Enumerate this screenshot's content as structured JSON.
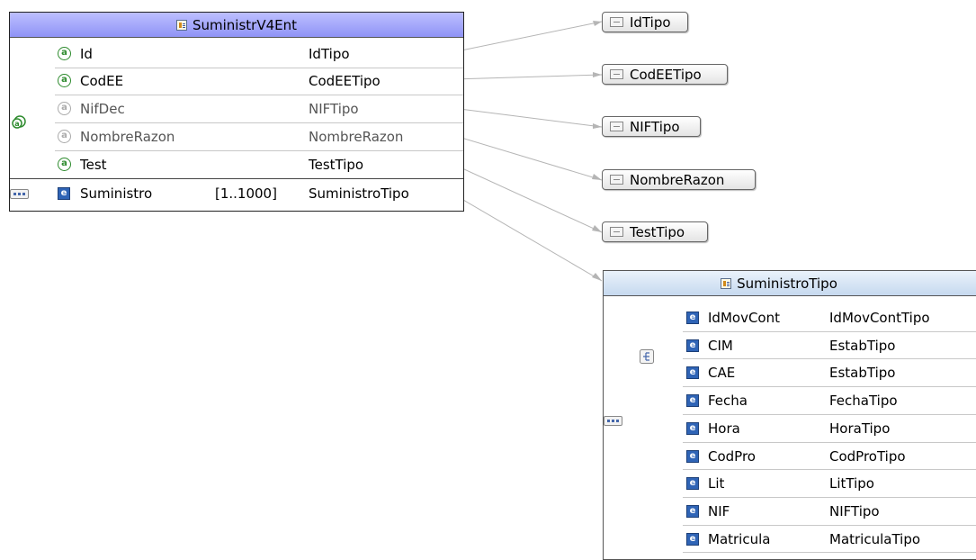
{
  "main_type": {
    "title": "SuministrV4Ent",
    "rows": [
      {
        "kind": "attribute",
        "optional": false,
        "name": "Id",
        "card": "",
        "type": "IdTipo"
      },
      {
        "kind": "attribute",
        "optional": false,
        "name": "CodEE",
        "card": "",
        "type": "CodEETipo"
      },
      {
        "kind": "attribute",
        "optional": true,
        "name": "NifDec",
        "card": "",
        "type": "NIFTipo"
      },
      {
        "kind": "attribute",
        "optional": true,
        "name": "NombreRazon",
        "card": "",
        "type": "NombreRazon"
      },
      {
        "kind": "attribute",
        "optional": false,
        "name": "Test",
        "card": "",
        "type": "TestTipo"
      },
      {
        "kind": "element",
        "optional": false,
        "name": "Suministro",
        "card": "[1..1000]",
        "type": "SuministroTipo"
      }
    ],
    "attribute_icon_glyph": "a",
    "element_icon_glyph": "e"
  },
  "simple_types": [
    {
      "label": "IdTipo"
    },
    {
      "label": "CodEETipo"
    },
    {
      "label": "NIFTipo"
    },
    {
      "label": "NombreRazon"
    },
    {
      "label": "TestTipo"
    }
  ],
  "complex_type": {
    "title": "SuministroTipo",
    "rows": [
      {
        "name": "IdMovCont",
        "type": "IdMovContTipo"
      },
      {
        "name": "CIM",
        "type": "EstabTipo"
      },
      {
        "name": "CAE",
        "type": "EstabTipo"
      },
      {
        "name": "Fecha",
        "type": "FechaTipo"
      },
      {
        "name": "Hora",
        "type": "HoraTipo"
      },
      {
        "name": "CodPro",
        "type": "CodProTipo"
      },
      {
        "name": "Lit",
        "type": "LitTipo"
      },
      {
        "name": "NIF",
        "type": "NIFTipo"
      },
      {
        "name": "Matricula",
        "type": "MatriculaTipo"
      }
    ]
  },
  "colors": {
    "main_header": "#8f93f6",
    "complex_header": "#c6d9ef",
    "attribute_required": "#2e8b2e",
    "attribute_optional": "#aaaaaa",
    "element_icon": "#2f64b6",
    "connector": "#b0b0b0"
  },
  "icons": {
    "complex_type": "complex-type-icon",
    "simple_type": "simple-type-icon",
    "attribute": "attribute-icon",
    "element": "element-icon",
    "sequence": "sequence-icon",
    "attribute_group": "attribute-group-icon",
    "choice": "choice-icon"
  }
}
